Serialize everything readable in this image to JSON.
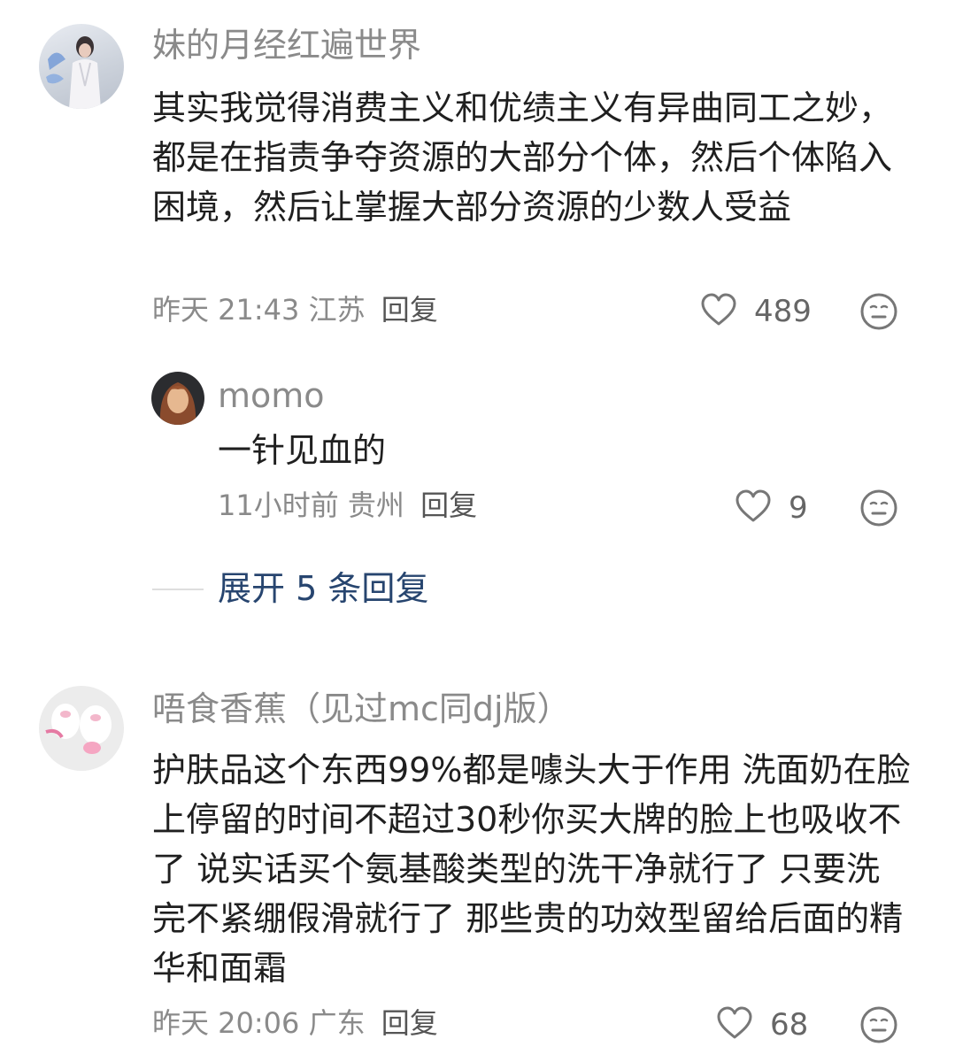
{
  "comments": [
    {
      "username": "妹的月经红遍世界",
      "text": "其实我觉得消费主义和优绩主义有异曲同工之妙，都是在指责争夺资源的大部分个体，然后个体陷入困境，然后让掌握大部分资源的少数人受益",
      "time": "昨天 21:43",
      "location": "江苏",
      "reply_label": "回复",
      "likes": "489",
      "replies": [
        {
          "username": "momo",
          "text": "一针见血的",
          "time": "11小时前",
          "location": "贵州",
          "reply_label": "回复",
          "likes": "9"
        }
      ],
      "expand_label": "展开 5 条回复"
    },
    {
      "username": "唔食香蕉（见过mc同dj版）",
      "text": "护肤品这个东西99%都是噱头大于作用 洗面奶在脸上停留的时间不超过30秒你买大牌的脸上也吸收不了 说实话买个氨基酸类型的洗干净就行了 只要洗完不紧绷假滑就行了 那些贵的功效型留给后面的精华和面霜",
      "time": "昨天 20:06",
      "location": "广东",
      "reply_label": "回复",
      "likes": "68"
    }
  ],
  "colors": {
    "username": "#8a8a8a",
    "text": "#1f1f1f",
    "expand_link": "#27456f"
  },
  "icons": {
    "like": "heart-outline-icon",
    "emoji": "neutral-face-icon"
  }
}
